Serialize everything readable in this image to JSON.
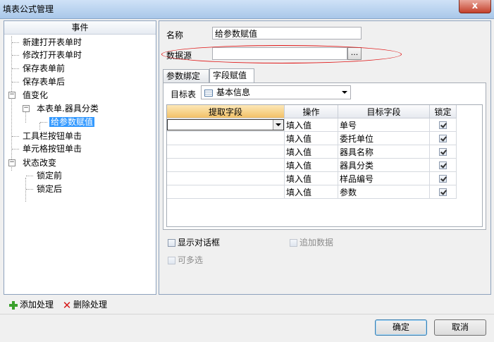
{
  "window": {
    "title": "填表公式管理",
    "close_glyph": "x"
  },
  "events": {
    "header": "事件",
    "items": [
      {
        "label": "新建打开表单时"
      },
      {
        "label": "修改打开表单时"
      },
      {
        "label": "保存表单前"
      },
      {
        "label": "保存表单后"
      },
      {
        "label": "值变化"
      },
      {
        "label": "本表单.器具分类"
      },
      {
        "label": "给参数赋值"
      },
      {
        "label": "工具栏按钮单击"
      },
      {
        "label": "单元格按钮单击"
      },
      {
        "label": "状态改变"
      },
      {
        "label": "锁定前"
      },
      {
        "label": "锁定后"
      }
    ],
    "expander_minus": "−"
  },
  "form": {
    "name_label": "名称",
    "name_value": "给参数赋值",
    "datasource_label": "数据源",
    "datasource_value": "",
    "ellipsis": "..."
  },
  "tabs": [
    {
      "label": "参数绑定"
    },
    {
      "label": "字段赋值"
    }
  ],
  "target": {
    "label": "目标表",
    "value": "基本信息"
  },
  "grid": {
    "columns": [
      "提取字段",
      "操作",
      "目标字段",
      "锁定"
    ],
    "rows": [
      {
        "extract": "",
        "op": "填入值",
        "target": "单号",
        "locked": true
      },
      {
        "extract": "",
        "op": "填入值",
        "target": "委托单位",
        "locked": true
      },
      {
        "extract": "",
        "op": "填入值",
        "target": "器具名称",
        "locked": true
      },
      {
        "extract": "",
        "op": "填入值",
        "target": "器具分类",
        "locked": true
      },
      {
        "extract": "",
        "op": "填入值",
        "target": "样品编号",
        "locked": true
      },
      {
        "extract": "",
        "op": "填入值",
        "target": "参数",
        "locked": true
      }
    ]
  },
  "options": {
    "show_dialog": {
      "label": "显示对话框",
      "checked": false
    },
    "append_data": {
      "label": "追加数据",
      "checked": false
    },
    "multi_select": {
      "label": "可多选",
      "checked": false
    }
  },
  "actions": {
    "add_label": "添加处理",
    "delete_label": "删除处理"
  },
  "buttons": {
    "ok": "确定",
    "cancel": "取消"
  },
  "colors": {
    "selection": "#3399ff",
    "annotation_ellipse": "#e01818",
    "header_selected": "#f2c167"
  }
}
